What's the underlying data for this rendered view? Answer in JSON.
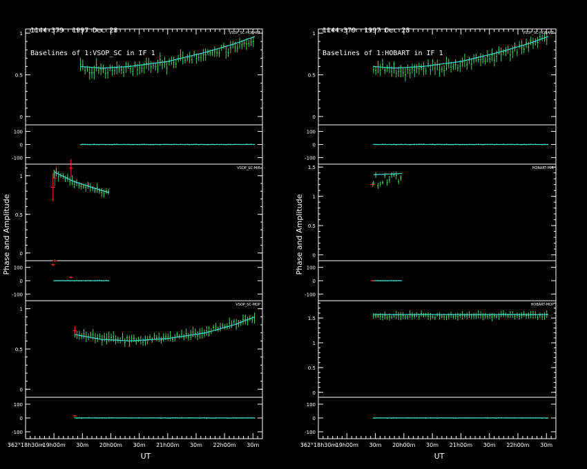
{
  "panels": [
    {
      "title1": "1144-379  1997 Dec 28",
      "title2": "Baselines of 1:VSOP_SC in IF 1",
      "ylabel": "Phase and Amplitude",
      "xlabel": "UT",
      "xticks": [
        {
          "t": 0,
          "text": "362°18h30m"
        },
        {
          "t": 30,
          "text": "19h00m"
        },
        {
          "t": 60,
          "text": "30m"
        },
        {
          "t": 90,
          "text": "20h00m"
        },
        {
          "t": 120,
          "text": "30m"
        },
        {
          "t": 150,
          "text": "21h00m"
        },
        {
          "t": 180,
          "text": "30m"
        },
        {
          "t": 210,
          "text": "22h00m"
        },
        {
          "t": 240,
          "text": "30m"
        }
      ]
    },
    {
      "title1": "1144-379  1997 Dec 28",
      "title2": "Baselines of 1:HOBART in IF 1",
      "ylabel": "Phase and Amplitude",
      "xlabel": "UT",
      "xticks": [
        {
          "t": 0,
          "text": "362°18h30m"
        },
        {
          "t": 30,
          "text": "19h00m"
        },
        {
          "t": 60,
          "text": "30m"
        },
        {
          "t": 90,
          "text": "20h00m"
        },
        {
          "t": 120,
          "text": "30m"
        },
        {
          "t": 150,
          "text": "21h00m"
        },
        {
          "t": 180,
          "text": "30m"
        },
        {
          "t": 210,
          "text": "22h00m"
        },
        {
          "t": 240,
          "text": "30m"
        }
      ]
    }
  ],
  "chart_data": [
    {
      "type": "scatter",
      "panel": 0,
      "baseline": "VSOP_SC-HOBART",
      "amp_range": [
        -0.1,
        1.05
      ],
      "amp_ticks": [
        0,
        0.5,
        1
      ],
      "amp_tick_labels": [
        "0",
        "0.5",
        "1"
      ],
      "phase_range": [
        -150,
        150
      ],
      "phase_ticks": [
        -100,
        0,
        100
      ],
      "phase_tick_labels": [
        "-100",
        "0",
        "100"
      ],
      "time": [
        58,
        242
      ],
      "step": 2.4,
      "amp_model": [
        [
          58,
          0.6
        ],
        [
          80,
          0.58
        ],
        [
          110,
          0.6
        ],
        [
          150,
          0.66
        ],
        [
          190,
          0.77
        ],
        [
          220,
          0.87
        ],
        [
          242,
          0.96
        ]
      ],
      "amp_scatter": 0.09,
      "amp_err": 0.06,
      "amp_mean_offset": -0.05,
      "phase_mean": 0,
      "phase_scatter": 3,
      "phase_err": 3,
      "phase_model": [
        [
          58,
          0
        ],
        [
          242,
          0
        ]
      ],
      "flagged": []
    },
    {
      "type": "scatter",
      "panel": 0,
      "baseline": "VSOP_SC-MIR",
      "amp_range": [
        -0.1,
        1.15
      ],
      "amp_ticks": [
        0,
        0.5,
        1
      ],
      "amp_tick_labels": [
        "0",
        "0.5",
        "1"
      ],
      "phase_range": [
        -150,
        150
      ],
      "phase_ticks": [
        -100,
        0,
        100
      ],
      "phase_tick_labels": [
        "-100",
        "0",
        "100"
      ],
      "time": [
        30,
        88
      ],
      "step": 2.4,
      "amp_model": [
        [
          30,
          1.05
        ],
        [
          50,
          0.93
        ],
        [
          70,
          0.85
        ],
        [
          88,
          0.78
        ]
      ],
      "amp_scatter": 0.05,
      "amp_err": 0.05,
      "amp_mean_offset": -0.03,
      "phase_mean": 0,
      "phase_scatter": 3,
      "phase_err": 3,
      "phase_model": [
        [
          30,
          0
        ],
        [
          88,
          0
        ]
      ],
      "flagged": [
        {
          "t": 29,
          "amp": 0.85,
          "amp_err": 0.18,
          "phase": 120,
          "phase_err": 10
        },
        {
          "t": 31,
          "amp": 0.97,
          "amp_err": 0.1,
          "phase": 150,
          "phase_err": 10
        },
        {
          "t": 48,
          "amp": 1.1,
          "amp_err": 0.12,
          "phase": 25,
          "phase_err": 8
        }
      ]
    },
    {
      "type": "scatter",
      "panel": 0,
      "baseline": "VSOP_SC-MOP",
      "amp_range": [
        -0.1,
        1.1
      ],
      "amp_ticks": [
        0,
        0.5,
        1
      ],
      "amp_tick_labels": [
        "0",
        "0.5",
        "1"
      ],
      "phase_range": [
        -150,
        150
      ],
      "phase_ticks": [
        -100,
        0,
        100
      ],
      "phase_tick_labels": [
        "-100",
        "0",
        "100"
      ],
      "time": [
        52,
        242
      ],
      "step": 2.4,
      "amp_model": [
        [
          52,
          0.68
        ],
        [
          80,
          0.62
        ],
        [
          110,
          0.6
        ],
        [
          150,
          0.63
        ],
        [
          190,
          0.7
        ],
        [
          220,
          0.8
        ],
        [
          242,
          0.9
        ]
      ],
      "amp_scatter": 0.06,
      "amp_err": 0.05,
      "amp_mean_offset": 0.02,
      "phase_mean": 0,
      "phase_scatter": 3,
      "phase_err": 3,
      "phase_model": [
        [
          52,
          0
        ],
        [
          242,
          0
        ]
      ],
      "flagged": [
        {
          "t": 52,
          "amp": 0.73,
          "amp_err": 0.05,
          "phase": 15,
          "phase_err": 5
        }
      ]
    },
    {
      "type": "scatter",
      "panel": 1,
      "baseline": "VSOP_SC-HOBART",
      "amp_range": [
        -0.1,
        1.05
      ],
      "amp_ticks": [
        0,
        0.5,
        1
      ],
      "amp_tick_labels": [
        "0",
        "0.5",
        "1"
      ],
      "phase_range": [
        -150,
        150
      ],
      "phase_ticks": [
        -100,
        0,
        100
      ],
      "phase_tick_labels": [
        "-100",
        "0",
        "100"
      ],
      "time": [
        58,
        242
      ],
      "step": 2.4,
      "amp_model": [
        [
          58,
          0.6
        ],
        [
          80,
          0.58
        ],
        [
          110,
          0.6
        ],
        [
          150,
          0.66
        ],
        [
          190,
          0.77
        ],
        [
          220,
          0.87
        ],
        [
          242,
          0.96
        ]
      ],
      "amp_scatter": 0.09,
      "amp_err": 0.06,
      "amp_mean_offset": -0.05,
      "phase_mean": 0,
      "phase_scatter": 3,
      "phase_err": 3,
      "phase_model": [
        [
          58,
          0
        ],
        [
          242,
          0
        ]
      ],
      "flagged": []
    },
    {
      "type": "scatter",
      "panel": 1,
      "baseline": "HOBART-MIR",
      "amp_range": [
        -0.1,
        1.55
      ],
      "amp_ticks": [
        0,
        0.5,
        1,
        1.5
      ],
      "amp_tick_labels": [
        "0",
        "0.5",
        "1",
        "1.5"
      ],
      "phase_range": [
        -150,
        150
      ],
      "phase_ticks": [
        -100,
        0,
        100
      ],
      "phase_tick_labels": [
        "-100",
        "0",
        "100"
      ],
      "time": [
        58,
        88
      ],
      "step": 2.4,
      "amp_model": [
        [
          58,
          1.37
        ],
        [
          88,
          1.39
        ]
      ],
      "amp_scatter": 0.05,
      "amp_err": 0.05,
      "amp_mean_offset": -0.18,
      "phase_mean": 0,
      "phase_scatter": 2,
      "phase_err": 2,
      "phase_model": [
        [
          58,
          0
        ],
        [
          88,
          0
        ]
      ],
      "flagged": [
        {
          "t": 57,
          "amp": 1.2,
          "amp_err": 0.04,
          "phase": 0,
          "phase_err": 6
        }
      ]
    },
    {
      "type": "scatter",
      "panel": 1,
      "baseline": "HOBART-MOP",
      "amp_range": [
        -0.1,
        1.85
      ],
      "amp_ticks": [
        0,
        0.5,
        1,
        1.5
      ],
      "amp_tick_labels": [
        "0",
        "0.5",
        "1",
        "1.5"
      ],
      "phase_range": [
        -150,
        150
      ],
      "phase_ticks": [
        -100,
        0,
        100
      ],
      "phase_tick_labels": [
        "-100",
        "0",
        "100"
      ],
      "time": [
        58,
        242
      ],
      "step": 2.4,
      "amp_model": [
        [
          58,
          1.57
        ],
        [
          242,
          1.57
        ]
      ],
      "amp_scatter": 0.05,
      "amp_err": 0.06,
      "amp_mean_offset": -0.05,
      "phase_mean": 0,
      "phase_scatter": 2,
      "phase_err": 3,
      "phase_model": [
        [
          58,
          0
        ],
        [
          242,
          0
        ]
      ],
      "flagged": []
    }
  ]
}
